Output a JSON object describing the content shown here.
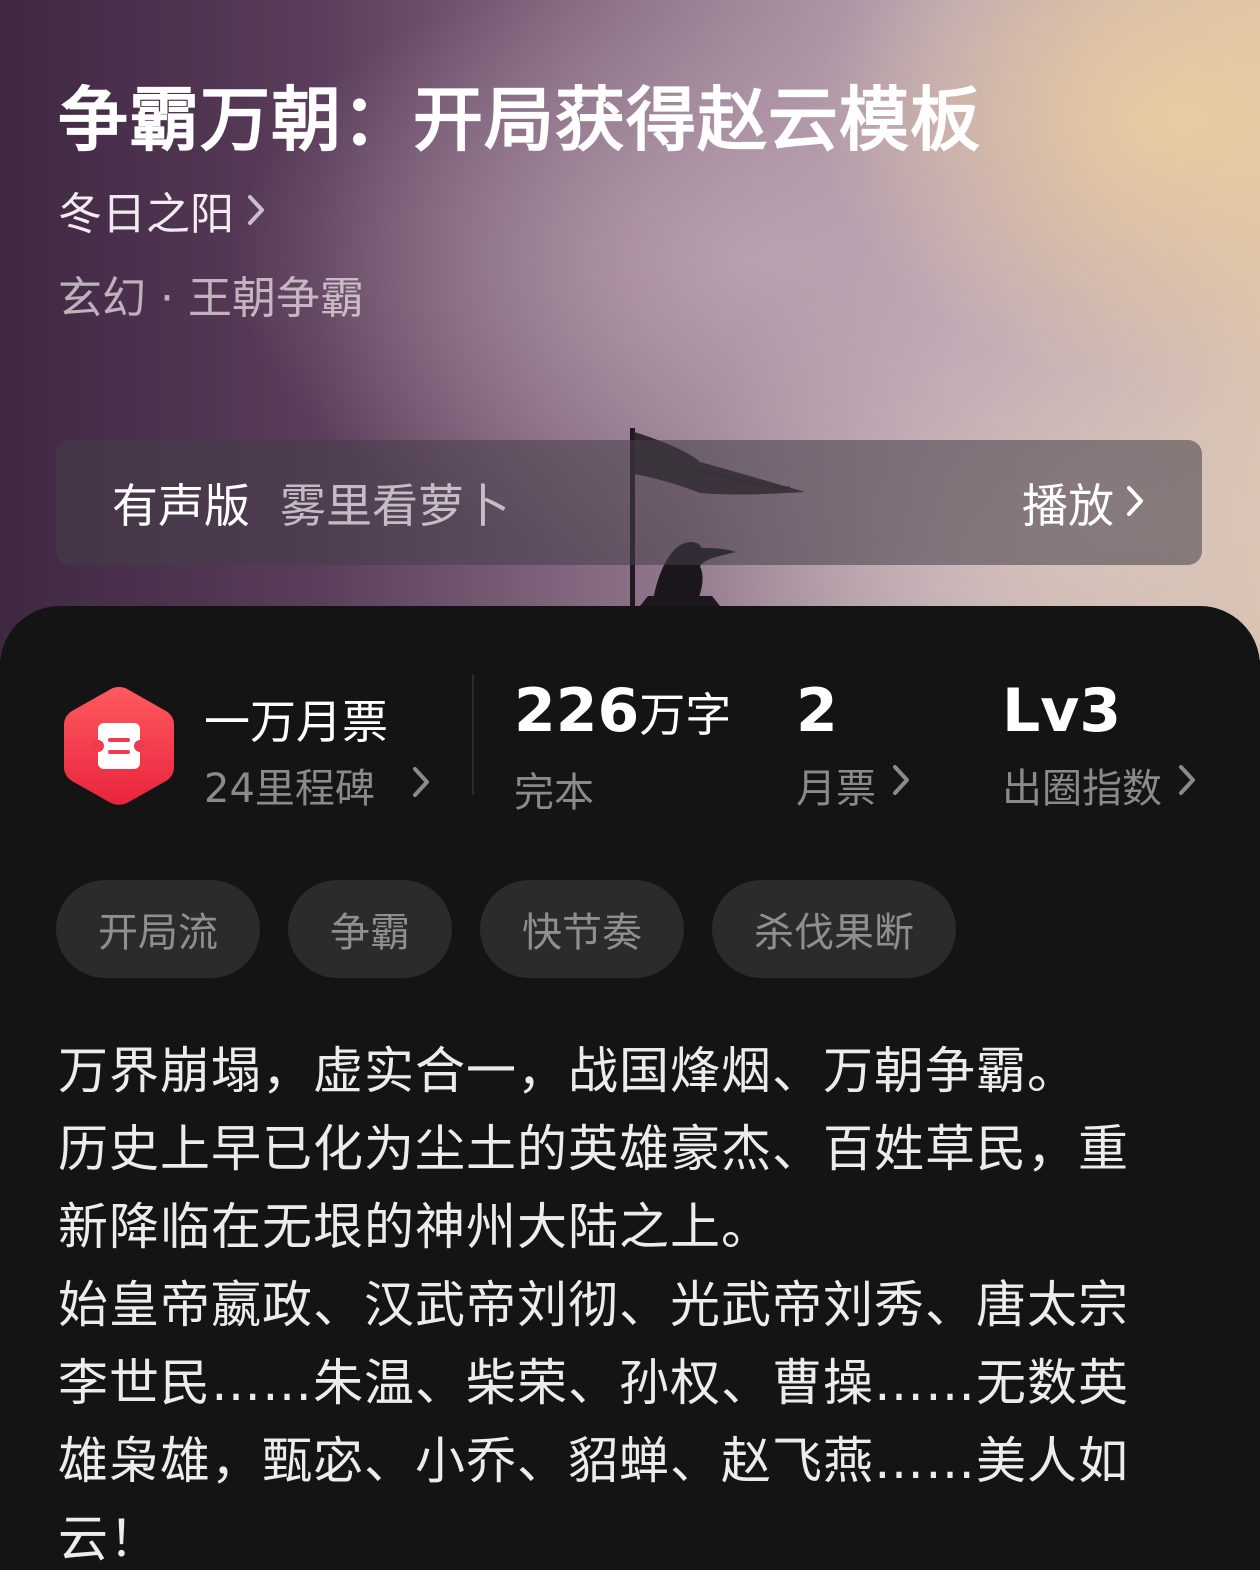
{
  "book": {
    "title": "争霸万朝：开局获得赵云模板",
    "author": "冬日之阳",
    "genre": "玄幻 · 王朝争霸"
  },
  "audio": {
    "label": "有声版",
    "narrator": "雾里看萝卜",
    "play_label": "播放"
  },
  "stats": {
    "ticket_title": "一万月票",
    "ticket_sub": "24里程碑",
    "word_count_value": "226",
    "word_count_unit": "万字",
    "word_count_label": "完本",
    "monthly_ticket_value": "2",
    "monthly_ticket_label": "月票",
    "level_value": "Lv3",
    "level_label": "出圈指数"
  },
  "tags": [
    "开局流",
    "争霸",
    "快节奏",
    "杀伐果断"
  ],
  "synopsis": [
    "万界崩塌，虚实合一，战国烽烟、万朝争霸。",
    "历史上早已化为尘土的英雄豪杰、百姓草民，重新降临在无垠的神州大陆之上。",
    "始皇帝嬴政、汉武帝刘彻、光武帝刘秀、唐太宗李世民……朱温、柴荣、孙权、曹操……无数英雄枭雄，甄宓、小乔、貂蝉、赵飞燕……美人如云！"
  ],
  "colors": {
    "badge": "#f23a4e",
    "sheet_bg": "#141414",
    "tag_bg": "#2b2b2b"
  }
}
